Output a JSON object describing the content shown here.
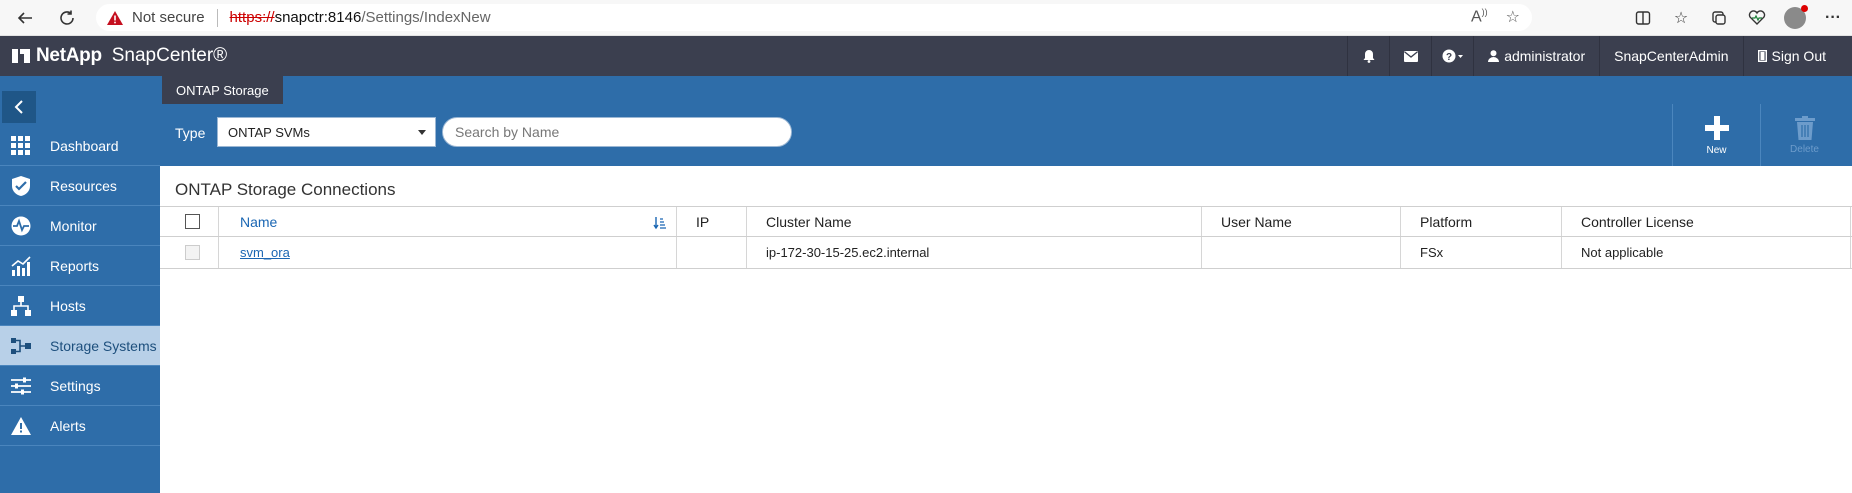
{
  "browser": {
    "not_secure": "Not secure",
    "url_protocol": "https://",
    "url_host": "snapctr:8146",
    "url_path": "/Settings/IndexNew"
  },
  "header": {
    "brand": "NetApp",
    "product": "SnapCenter®",
    "user": "administrator",
    "role": "SnapCenterAdmin",
    "sign_out": "Sign Out"
  },
  "sidebar": {
    "items": [
      {
        "label": "Dashboard",
        "icon": "grid-icon"
      },
      {
        "label": "Resources",
        "icon": "shield-check-icon"
      },
      {
        "label": "Monitor",
        "icon": "pulse-icon"
      },
      {
        "label": "Reports",
        "icon": "chart-icon"
      },
      {
        "label": "Hosts",
        "icon": "hierarchy-icon"
      },
      {
        "label": "Storage Systems",
        "icon": "storage-icon"
      },
      {
        "label": "Settings",
        "icon": "sliders-icon"
      },
      {
        "label": "Alerts",
        "icon": "warning-icon"
      }
    ],
    "active_index": 5
  },
  "main": {
    "tab": "ONTAP Storage",
    "type_label": "Type",
    "type_value": "ONTAP SVMs",
    "search_placeholder": "Search by Name",
    "new_label": "New",
    "delete_label": "Delete",
    "section_title": "ONTAP Storage Connections"
  },
  "table": {
    "columns": [
      "Name",
      "IP",
      "Cluster Name",
      "User Name",
      "Platform",
      "Controller License"
    ],
    "rows": [
      {
        "name": "svm_ora",
        "ip": "",
        "cluster_name": "ip-172-30-15-25.ec2.internal",
        "user_name": "",
        "platform": "FSx",
        "controller_license": "Not applicable"
      }
    ]
  },
  "colors": {
    "header_bg": "#3b3f4f",
    "sidebar_bg": "#2e6da9",
    "active_nav_bg": "#b8d0e8",
    "link": "#1a66b3"
  }
}
